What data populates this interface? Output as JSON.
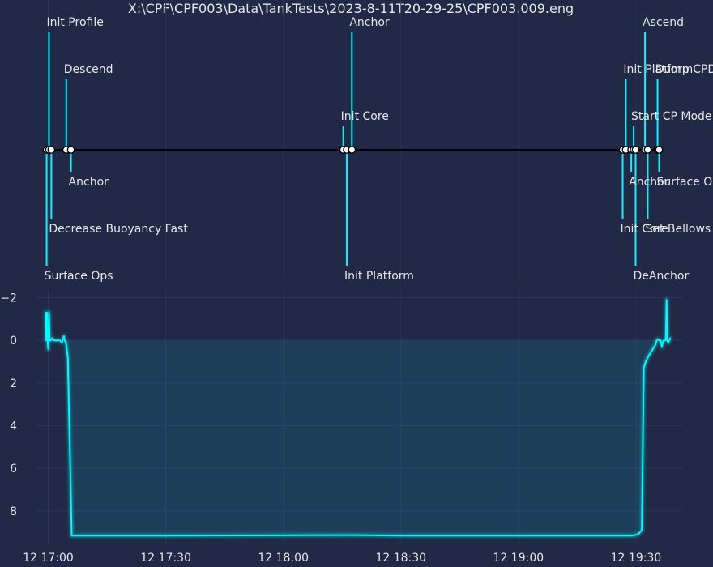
{
  "chart_data": {
    "type": "line",
    "title": "X:\\CPF\\CPF003\\Data\\TankTests\\2023-8-11T20-29-25\\CPF003.009.eng",
    "colors": {
      "background": "#212946",
      "grid": "#2A3459",
      "accent": "#08F7FE",
      "text": "#E6E6E6",
      "timeline": "#000000",
      "marker": "#FFFFFF"
    },
    "x_axis": {
      "type": "time",
      "range": [
        "12 16:57",
        "12 19:42"
      ],
      "ticks": [
        "12 17:00",
        "12 17:30",
        "12 18:00",
        "12 18:30",
        "12 19:00",
        "12 19:30"
      ],
      "grid": true
    },
    "y_axis": {
      "range": [
        9.6,
        -2.4
      ],
      "inverted": true,
      "ticks": [
        "−2",
        "0",
        "2",
        "4",
        "6",
        "8"
      ],
      "grid": true
    },
    "events": [
      {
        "time": "12 16:59.6",
        "label": "Surface Ops",
        "level": -3
      },
      {
        "time": "12 17:00.2",
        "label": "Init Profile",
        "level": 3
      },
      {
        "time": "12 17:00.8",
        "label": "Decrease Buoyancy Fast",
        "level": -2
      },
      {
        "time": "12 17:04.6",
        "label": "Descend",
        "level": 2
      },
      {
        "time": "12 17:05.8",
        "label": "Anchor",
        "level": -1
      },
      {
        "time": "12 18:15.3",
        "label": "Init Core",
        "level": 1
      },
      {
        "time": "12 18:16.2",
        "label": "Init Platform",
        "level": -3
      },
      {
        "time": "12 18:17.5",
        "label": "Anchor",
        "level": 3
      },
      {
        "time": "12 19:26.6",
        "label": "Init Core",
        "level": -2
      },
      {
        "time": "12 19:27.4",
        "label": "Init Platform",
        "level": 2
      },
      {
        "time": "12 19:28.8",
        "label": "Anchor",
        "level": -1
      },
      {
        "time": "12 19:29.4",
        "label": "Start CP Mode",
        "level": 1
      },
      {
        "time": "12 19:29.9",
        "label": "DeAnchor",
        "level": -3
      },
      {
        "time": "12 19:32.3",
        "label": "Ascend",
        "level": 3
      },
      {
        "time": "12 19:33.0",
        "label": "Set Bellows",
        "level": -2
      },
      {
        "time": "12 19:35.5",
        "label": "Dump CPData",
        "level": 2
      },
      {
        "time": "12 19:35.9",
        "label": "Surface Ops",
        "level": -1
      }
    ],
    "series": [
      {
        "x": [
          "12 16:59.4",
          "12 16:59.5",
          "12 16:59.6",
          "12 16:59.7",
          "12 16:59.8",
          "12 17:00.0",
          "12 17:00.2",
          "12 17:00.4",
          "12 17:00.6",
          "12 17:00.8",
          "12 17:01.0",
          "12 17:01.5",
          "12 17:02.0",
          "12 17:02.5",
          "12 17:03.0",
          "12 17:03.5",
          "12 17:04.0",
          "12 17:04.2",
          "12 17:04.5",
          "12 17:05.0",
          "12 17:06.0",
          "12 17:30",
          "12 18:00",
          "12 18:18",
          "12 18:30",
          "12 19:00",
          "12 19:27",
          "12 19:29",
          "12 19:30.5",
          "12 19:31.5",
          "12 19:32.0",
          "12 19:32.5",
          "12 19:33.0",
          "12 19:34.0",
          "12 19:35.0",
          "12 19:35.3",
          "12 19:35.6",
          "12 19:35.9",
          "12 19:36.3",
          "12 19:36.6",
          "12 19:37.0",
          "12 19:37.3",
          "12 19:37.6",
          "12 19:37.8",
          "12 19:38.0",
          "12 19:38.2",
          "12 19:38.5",
          "12 19:38.7"
        ],
        "y": [
          -1.3,
          0.0,
          -0.1,
          -1.3,
          0.0,
          0.4,
          -1.3,
          0.0,
          0.0,
          0.0,
          -0.1,
          0.0,
          0.0,
          0.0,
          0.0,
          0.1,
          -0.2,
          0.0,
          0.1,
          0.8,
          9.15,
          9.15,
          9.14,
          9.13,
          9.15,
          9.15,
          9.15,
          9.15,
          9.1,
          8.9,
          1.3,
          1.0,
          0.8,
          0.5,
          0.2,
          0.0,
          -0.05,
          0.0,
          0.0,
          0.3,
          0.0,
          0.0,
          0.0,
          -1.9,
          0.0,
          0.1,
          0.0,
          -0.1
        ]
      }
    ]
  }
}
